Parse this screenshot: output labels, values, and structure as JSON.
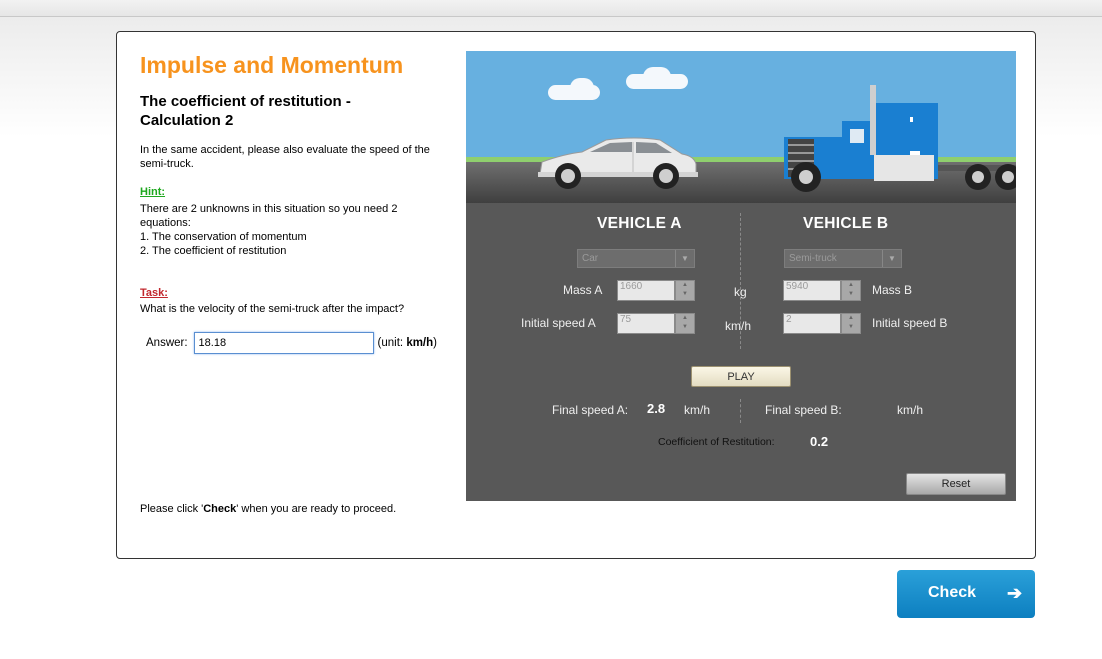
{
  "lesson": {
    "title": "Impulse and Momentum",
    "subtitle": "The coefficient of restitution - Calculation 2",
    "intro": "In the same accident, please also evaluate the speed of the semi-truck.",
    "hint_label": "Hint:",
    "hint_lines": [
      "There are 2 unknowns in this situation so you need 2 equations:",
      "1. The conservation of momentum",
      "2. The coefficient of restitution"
    ],
    "task_label": "Task:",
    "task_text": "What is the velocity of the semi-truck after the impact?",
    "answer_label": "Answer:",
    "answer_value": "18.18",
    "unit_prefix": "(unit: ",
    "unit_value": "km/h",
    "unit_suffix": ")",
    "proceed_prefix": "Please click '",
    "proceed_bold": "Check",
    "proceed_suffix": "' when you are ready to proceed."
  },
  "simulation": {
    "vehicle_a": {
      "heading": "VEHICLE A",
      "type": "Car",
      "mass_label": "Mass A",
      "mass": "1660",
      "speed_label": "Initial speed A",
      "initial_speed": "75",
      "final_label": "Final speed A:",
      "final_speed": "2.8",
      "final_unit": "km/h"
    },
    "vehicle_b": {
      "heading": "VEHICLE B",
      "type": "Semi-truck",
      "mass_label": "Mass B",
      "mass": "5940",
      "speed_label": "Initial speed B",
      "initial_speed": "2",
      "final_label": "Final speed B:",
      "final_unit": "km/h"
    },
    "mass_unit": "kg",
    "speed_unit": "km/h",
    "play_label": "PLAY",
    "coef_label": "Coefficient of Restitution:",
    "coef_value": "0.2",
    "reset_label": "Reset"
  },
  "footer": {
    "check_label": "Check",
    "check_icon": "arrow-right-icon"
  },
  "colors": {
    "title": "#f7931e",
    "hint": "#1fa81f",
    "task": "#c1272d",
    "sky": "#67b0e0",
    "truck": "#1a7fd1",
    "check_button": "#1690cf"
  }
}
